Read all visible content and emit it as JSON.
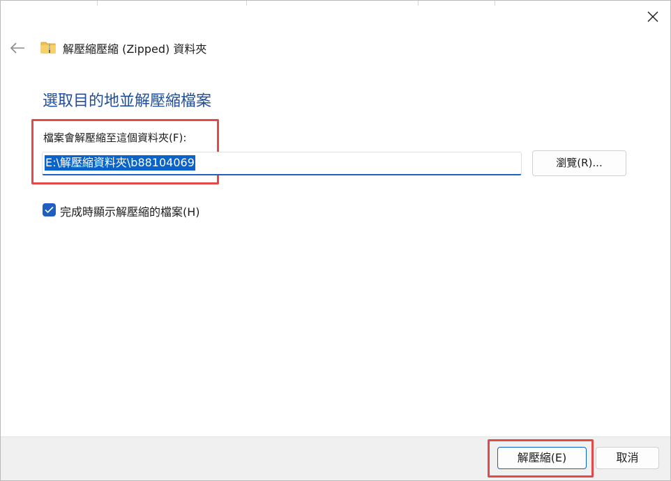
{
  "window": {
    "title": "解壓縮壓縮 (Zipped) 資料夾",
    "close_icon": "close-icon",
    "back_icon": "back-arrow-icon",
    "folder_icon": "zip-folder-icon"
  },
  "main": {
    "heading": "選取目的地並解壓縮檔案",
    "field_label": "檔案會解壓縮至這個資料夾(F):",
    "path_value": "E:\\解壓縮資料夾\\b88104069",
    "browse_label": "瀏覽(R)...",
    "checkbox_label": "完成時顯示解壓縮的檔案(H)",
    "checkbox_checked": true
  },
  "footer": {
    "extract_label": "解壓縮(E)",
    "cancel_label": "取消"
  },
  "colors": {
    "accent": "#1f5fbf",
    "heading": "#1f4e9c",
    "highlight": "#e24a4a",
    "selection": "#0a63c9"
  }
}
